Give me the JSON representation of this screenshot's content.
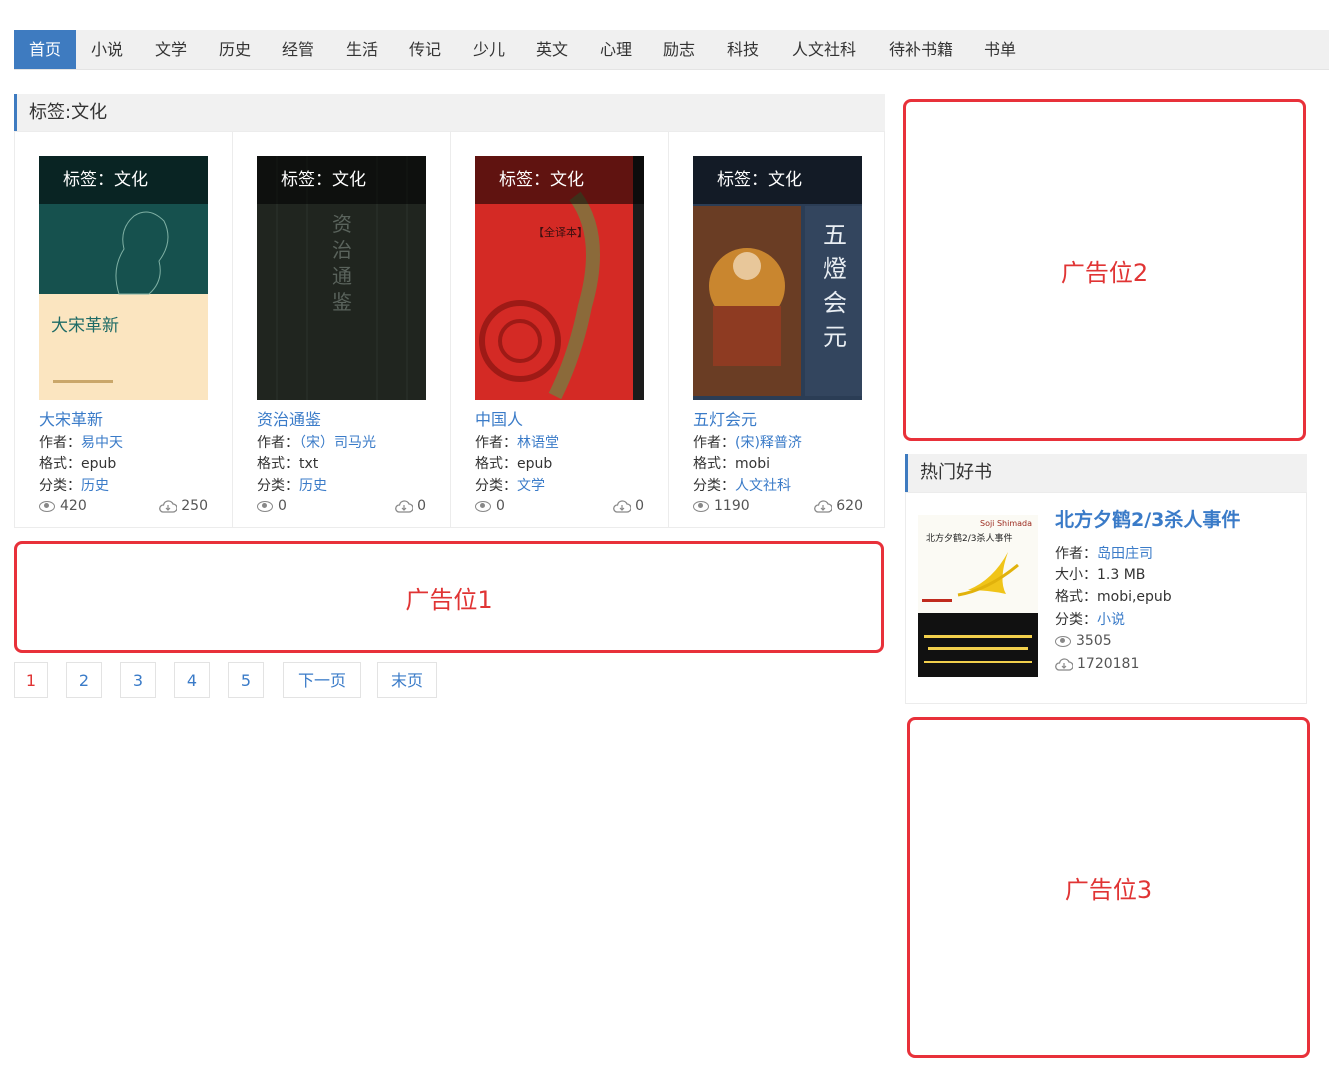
{
  "nav": {
    "items": [
      "首页",
      "小说",
      "文学",
      "历史",
      "经管",
      "生活",
      "传记",
      "少儿",
      "英文",
      "心理",
      "励志",
      "科技",
      "人文社科",
      "待补书籍",
      "书单"
    ],
    "active": "首页"
  },
  "section": {
    "title": "标签:文化"
  },
  "labels": {
    "author": "作者：",
    "format": "格式：",
    "category": "分类：",
    "size": "大小："
  },
  "books": [
    {
      "cover_tag": "标签：文化",
      "title": "大宋革新",
      "author": "易中天",
      "format": "epub",
      "category": "历史",
      "views": "420",
      "downloads": "250",
      "cover_text": "大宋革新"
    },
    {
      "cover_tag": "标签：文化",
      "title": "资治通鉴",
      "author": "（宋）司马光",
      "format": "txt",
      "category": "历史",
      "views": "0",
      "downloads": "0",
      "cover_text": "资治通鉴"
    },
    {
      "cover_tag": "标签：文化",
      "title": "中国人",
      "author": "林语堂",
      "format": "epub",
      "category": "文学",
      "views": "0",
      "downloads": "0",
      "cover_text": "【全译本】"
    },
    {
      "cover_tag": "标签：文化",
      "title": "五灯会元",
      "author": "(宋)释普济",
      "format": "mobi",
      "category": "人文社科",
      "views": "1190",
      "downloads": "620",
      "cover_text": "五燈会元"
    }
  ],
  "ads": {
    "ad1": "广告位1",
    "ad2": "广告位2",
    "ad3": "广告位3"
  },
  "pagination": {
    "pages": [
      "1",
      "2",
      "3",
      "4",
      "5"
    ],
    "next": "下一页",
    "last": "末页",
    "current": "1"
  },
  "hot": {
    "title": "热门好书",
    "book": {
      "title": "北方夕鹤2/3杀人事件",
      "author": "岛田庄司",
      "size": "1.3 MB",
      "format": "mobi,epub",
      "category": "小说",
      "views": "3505",
      "downloads": "1720181",
      "cover_title": "北方夕鹤2/3杀人事件",
      "cover_author": "Soji Shimada"
    }
  },
  "colors": {
    "accent": "#3e7bc0",
    "link": "#3a7bc8",
    "ad_border": "#e8313a"
  }
}
